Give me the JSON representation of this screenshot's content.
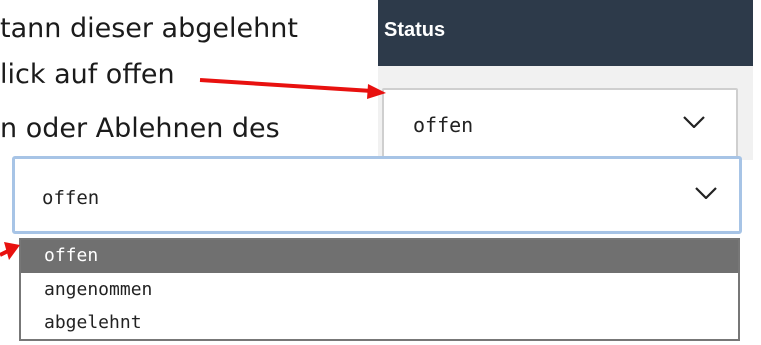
{
  "instructions": {
    "line1": "tann dieser abgelehnt",
    "line2": "lick auf offen",
    "line3": "n oder Ablehnen des"
  },
  "status_panel": {
    "header": "Status",
    "select_value": "offen"
  },
  "dropdown": {
    "value": "offen",
    "options": [
      "offen",
      "angenommen",
      "abgelehnt"
    ],
    "selected_index": 0
  },
  "colors": {
    "header_bg": "#2d3a4a",
    "annotation_arrow": "#e8110f",
    "selected_option_bg": "#707070",
    "focus_border": "#a7c4e6"
  },
  "icons": [
    "chevron-down-icon",
    "annotation-arrow"
  ]
}
